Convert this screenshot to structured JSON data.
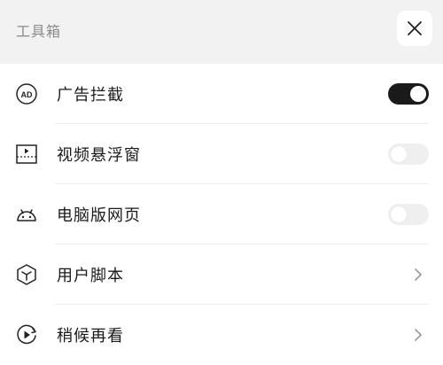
{
  "header": {
    "title": "工具箱",
    "close_icon": "close-icon"
  },
  "items": [
    {
      "label": "广告拦截",
      "icon": "ad-block-icon",
      "control": "toggle",
      "enabled": true
    },
    {
      "label": "视频悬浮窗",
      "icon": "video-float-icon",
      "control": "toggle",
      "enabled": false
    },
    {
      "label": "电脑版网页",
      "icon": "android-icon",
      "control": "toggle",
      "enabled": false
    },
    {
      "label": "用户脚本",
      "icon": "cube-icon",
      "control": "chevron"
    },
    {
      "label": "稍候再看",
      "icon": "play-later-icon",
      "control": "chevron"
    }
  ],
  "colors": {
    "header_bg": "#f2f2f2",
    "toggle_on": "#1a1a1a",
    "toggle_off": "#efefef",
    "text": "#1a1a1a"
  }
}
